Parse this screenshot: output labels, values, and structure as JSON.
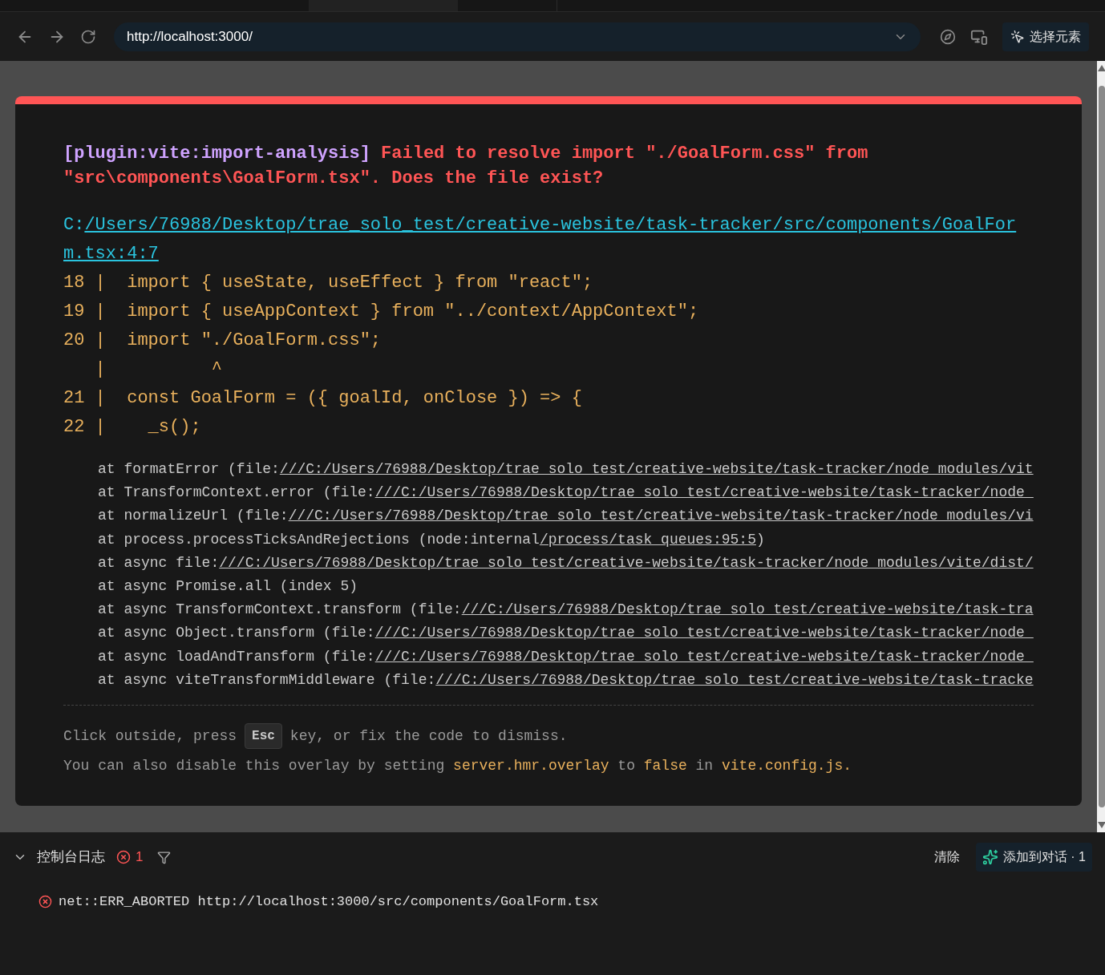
{
  "browser": {
    "url": "http://localhost:3000/",
    "inspect_button": "选择元素"
  },
  "overlay": {
    "plugin": "[plugin:vite:import-analysis]",
    "message": "Failed to resolve import \"./GoalForm.css\" from \"src\\components\\GoalForm.tsx\". Does the file exist?",
    "file_prefix": "C:",
    "file_link": "/Users/76988/Desktop/trae_solo_test/creative-website/task-tracker/src/components/GoalForm.tsx:4:7",
    "code_lines": [
      "18 |  import { useState, useEffect } from \"react\";",
      "19 |  import { useAppContext } from \"../context/AppContext\";",
      "20 |  import \"./GoalForm.css\";",
      "   |          ^",
      "21 |  const GoalForm = ({ goalId, onClose }) => {",
      "22 |    _s();"
    ],
    "stack": [
      {
        "pre": "at formatError (file:",
        "link": "///C:/Users/76988/Desktop/trae_solo_test/creative-website/task-tracker/node_modules/vit"
      },
      {
        "pre": "at TransformContext.error (file:",
        "link": "///C:/Users/76988/Desktop/trae_solo_test/creative-website/task-tracker/node_"
      },
      {
        "pre": "at normalizeUrl (file:",
        "link": "///C:/Users/76988/Desktop/trae_solo_test/creative-website/task-tracker/node_modules/vi"
      },
      {
        "pre": "at process.processTicksAndRejections (node:internal",
        "link": "/process/task_queues:95:5",
        "post": ")"
      },
      {
        "pre": "at async file:",
        "link": "///C:/Users/76988/Desktop/trae_solo_test/creative-website/task-tracker/node_modules/vite/dist/"
      },
      {
        "pre": "at async Promise.all (index 5)"
      },
      {
        "pre": "at async TransformContext.transform (file:",
        "link": "///C:/Users/76988/Desktop/trae_solo_test/creative-website/task-tra"
      },
      {
        "pre": "at async Object.transform (file:",
        "link": "///C:/Users/76988/Desktop/trae_solo_test/creative-website/task-tracker/node_"
      },
      {
        "pre": "at async loadAndTransform (file:",
        "link": "///C:/Users/76988/Desktop/trae_solo_test/creative-website/task-tracker/node_"
      },
      {
        "pre": "at async viteTransformMiddleware (file:",
        "link": "///C:/Users/76988/Desktop/trae_solo_test/creative-website/task-tracke"
      }
    ],
    "tip_before": "Click outside, press",
    "tip_key": "Esc",
    "tip_after": "key, or fix the code to dismiss.",
    "note": [
      {
        "kind": "text",
        "text": "You can also disable this overlay by setting "
      },
      {
        "kind": "code",
        "text": "server.hmr.overlay"
      },
      {
        "kind": "text",
        "text": " to "
      },
      {
        "kind": "code",
        "text": "false"
      },
      {
        "kind": "text",
        "text": " in "
      },
      {
        "kind": "code",
        "text": "vite.config.js."
      }
    ]
  },
  "console": {
    "title": "控制台日志",
    "error_count": "1",
    "expanded": true,
    "clear_button": "清除",
    "add_button": "添加到对话 · 1",
    "entries": [
      {
        "kind": "error",
        "text": "net::ERR_ABORTED http://localhost:3000/src/components/GoalForm.tsx"
      }
    ]
  }
}
